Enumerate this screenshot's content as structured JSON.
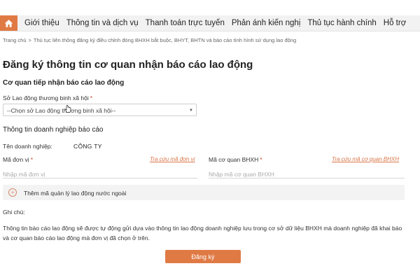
{
  "nav": {
    "home_icon": "home-icon",
    "items": [
      "Giới thiệu",
      "Thông tin và dịch vụ",
      "Thanh toán trực tuyến",
      "Phản ánh kiến nghị",
      "Thủ tục hành chính",
      "Hỗ trợ"
    ]
  },
  "breadcrumb": {
    "home": "Trang chủ",
    "separator": ">",
    "current": "Thủ tục liên thông đăng ký điều chỉnh đóng BHXH bắt buộc, BHYT, BHTN và báo cáo tình hình sử dụng lao động"
  },
  "page_title": "Đăng ký thông tin cơ quan nhận báo cáo lao động",
  "receiver": {
    "heading": "Cơ quan tiếp nhận báo cáo lao động",
    "field_label": "Sở Lao động thương binh xã hội",
    "required_mark": "*",
    "select_value": "--Chọn sở Lao động thương binh xã hội--"
  },
  "company": {
    "heading": "Thông tin doanh nghiệp báo cáo",
    "name_label": "Tên doanh nghiệp:",
    "name_value": "CÔNG TY",
    "unit_code_label": "Mã đơn vị",
    "unit_code_lookup": "Tra cứu mã đơn vị",
    "unit_code_placeholder": "Nhập mã đơn vị",
    "bhxh_label": "Mã cơ quan BHXH",
    "bhxh_lookup": "Tra cứu mã cơ quan BHXH",
    "bhxh_placeholder": "Nhập mã cơ quan BHXH",
    "required_mark": "*"
  },
  "add_foreign": "Thêm mã quản lý lao động nước ngoài",
  "note": {
    "label": "Ghi chú:",
    "text": "Thông tin báo cáo lao động sẽ được tự động gửi dựa vào thông tin lao động doanh nghiệp lưu trong cơ sở dữ liệu BHXH mà doanh nghiệp đã khai báo và cơ quan báo cáo lao động mà đơn vị đã chọn ở trên."
  },
  "submit_label": "Đăng ký",
  "colors": {
    "accent": "#e07a45",
    "link": "#d8764a"
  }
}
